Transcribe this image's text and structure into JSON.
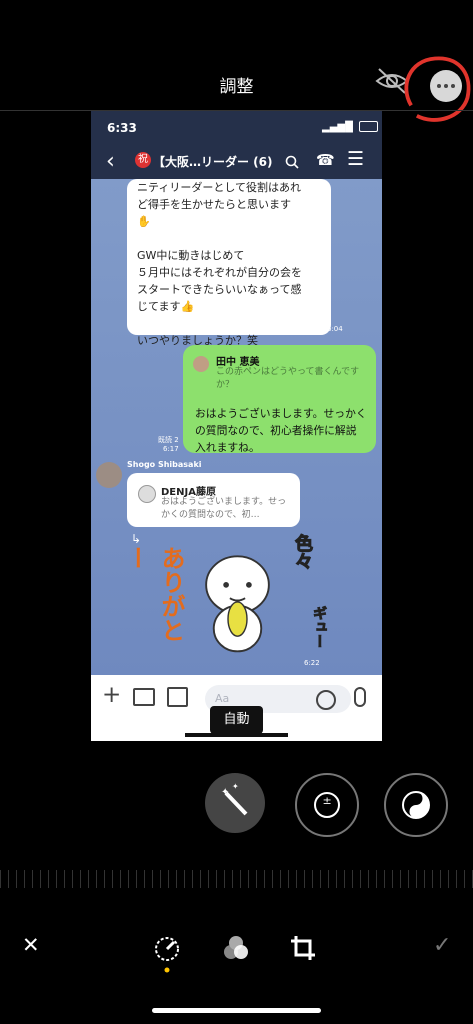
{
  "top": {
    "title": "調整"
  },
  "phone": {
    "time": "6:33",
    "chat_badge": "祝",
    "chat_title": "【大阪…リーダー (6)",
    "messages": [
      {
        "lines": [
          "ニティリーダーとして役割はあれ",
          "ど得手を生かせたらと思います",
          "✋",
          "",
          "GW中に動きはじめて",
          "５月中にはそれぞれが自分の会を",
          "スタートできたらいいなぁって感",
          "じてます👍",
          "",
          "いつやりましょうか？笑"
        ],
        "time": "6:04"
      },
      {
        "quote_name": "田中 恵美",
        "quote_text": "この赤ペンはどうやって書くんですか？",
        "text": "おはようございまします。せっかくの質問なので、初心者操作に解説入れますね。",
        "read": "既読 2",
        "time": "6:17"
      },
      {
        "sender": "Shogo Shibasaki",
        "quote_name": "DENJA藤原",
        "quote_text": "おはようございまします。せっかくの質問なので、初…",
        "sticker_text_left": "ありがとー",
        "sticker_text_right": "色々",
        "sticker_text_gyu": "ギュー",
        "time": "6:22"
      }
    ],
    "input_placeholder": "Aa"
  },
  "auto_label": "自動",
  "icons": [
    "eye-off-icon",
    "more-icon",
    "back-icon",
    "search-icon",
    "phone-icon",
    "menu-icon",
    "plus-icon",
    "camera-icon",
    "image-icon",
    "emoji-icon",
    "mic-icon",
    "magic-wand-icon",
    "exposure-icon",
    "yin-yang-icon",
    "close-icon",
    "adjust-icon",
    "filter-icon",
    "crop-icon",
    "check-icon"
  ],
  "colors": {
    "red_annotation": "#e0342c",
    "green_bubble": "#8de06d",
    "dark_header": "#25304a"
  }
}
